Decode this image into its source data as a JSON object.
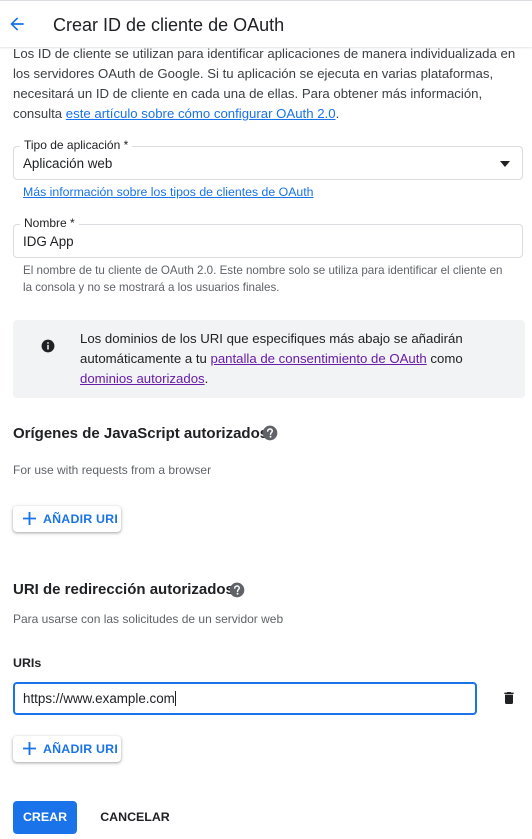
{
  "header": {
    "title": "Crear ID de cliente de OAuth"
  },
  "intro": {
    "text": "Los ID de cliente se utilizan para identificar aplicaciones de manera individualizada en los servidores OAuth de Google. Si tu aplicación se ejecuta en varias plataformas, necesitará un ID de cliente en cada una de ellas. Para obtener más información, consulta ",
    "link": "este artículo sobre cómo configurar OAuth 2.0",
    "suffix": "."
  },
  "app_type": {
    "label": "Tipo de aplicación *",
    "value": "Aplicación web",
    "more_link": "Más información sobre los tipos de clientes de OAuth"
  },
  "name": {
    "label": "Nombre *",
    "value": "IDG App",
    "hint": "El nombre de tu cliente de OAuth 2.0. Este nombre solo se utiliza para identificar el cliente en la consola y no se mostrará a los usuarios finales."
  },
  "info": {
    "text1": "Los dominios de los URI que especifiques más abajo se añadirán automáticamente a tu ",
    "link1": "pantalla de consentimiento de OAuth",
    "text2": " como ",
    "link2": "dominios autorizados",
    "text3": "."
  },
  "js_origins": {
    "title": "Orígenes de JavaScript autorizados",
    "subtitle": "For use with requests from a browser",
    "add_label": "AÑADIR URI"
  },
  "redirect": {
    "title": "URI de redirección autorizados",
    "subtitle": "Para usarse con las solicitudes de un servidor web",
    "uris_label": "URIs",
    "uri_value": "https://www.example.com",
    "add_label": "AÑADIR URI"
  },
  "actions": {
    "create": "CREAR",
    "cancel": "CANCELAR"
  },
  "colors": {
    "accent": "#1a73e8",
    "visited_link": "#681da8",
    "info_bg": "#f1f3f4"
  },
  "icons": {
    "back": "arrow-left-icon",
    "dropdown": "caret-down-icon",
    "info": "info-icon",
    "help": "help-circle-icon",
    "add": "plus-icon",
    "delete": "trash-icon"
  }
}
